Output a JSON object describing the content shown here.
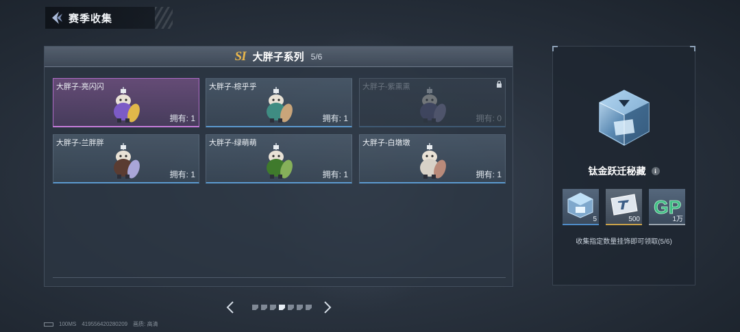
{
  "header": {
    "title": "赛季收集"
  },
  "panel": {
    "series_icon": "SI",
    "series_title": "大胖子系列",
    "series_progress": "5/6",
    "cards": [
      {
        "name": "大胖子-亮闪闪",
        "count": "拥有: 1",
        "selected": true,
        "locked": false,
        "body_color": "#7c5bc6",
        "accent_color": "#e0b84a"
      },
      {
        "name": "大胖子-棕乎乎",
        "count": "拥有: 1",
        "selected": false,
        "locked": false,
        "body_color": "#3f8c82",
        "accent_color": "#c9a57a"
      },
      {
        "name": "大胖子-紫熏熏",
        "count": "拥有: 0",
        "selected": false,
        "locked": true,
        "body_color": "#5a5a8a",
        "accent_color": "#8a86b0"
      },
      {
        "name": "大胖子-兰胖胖",
        "count": "拥有: 1",
        "selected": false,
        "locked": false,
        "body_color": "#5a3c32",
        "accent_color": "#a9a6d8"
      },
      {
        "name": "大胖子-绿萌萌",
        "count": "拥有: 1",
        "selected": false,
        "locked": false,
        "body_color": "#3f7a2c",
        "accent_color": "#86b05a"
      },
      {
        "name": "大胖子-白墩墩",
        "count": "拥有: 1",
        "selected": false,
        "locked": false,
        "body_color": "#d8d2c8",
        "accent_color": "#b98a7a"
      }
    ]
  },
  "pager": {
    "pages": 7,
    "active_index": 3
  },
  "status": {
    "ping": "100MS",
    "uid": "419556420280209",
    "quality_label": "画质:",
    "quality_value": "高清"
  },
  "reward": {
    "title": "钛金跃迁秘藏",
    "items": [
      {
        "icon": "crate-icon",
        "qty": "5"
      },
      {
        "icon": "ticket-icon",
        "qty": "500"
      },
      {
        "icon": "gp-coin-icon",
        "qty": "1万"
      }
    ],
    "gp_text": "GP",
    "description": "收集指定数量挂饰即可领取(5/6)"
  },
  "colors": {
    "accent_blue": "#5c9ad0",
    "selected_purple": "#c77ddc",
    "series_gold": "#e8b64c",
    "gp_green": "#3fbf84"
  }
}
